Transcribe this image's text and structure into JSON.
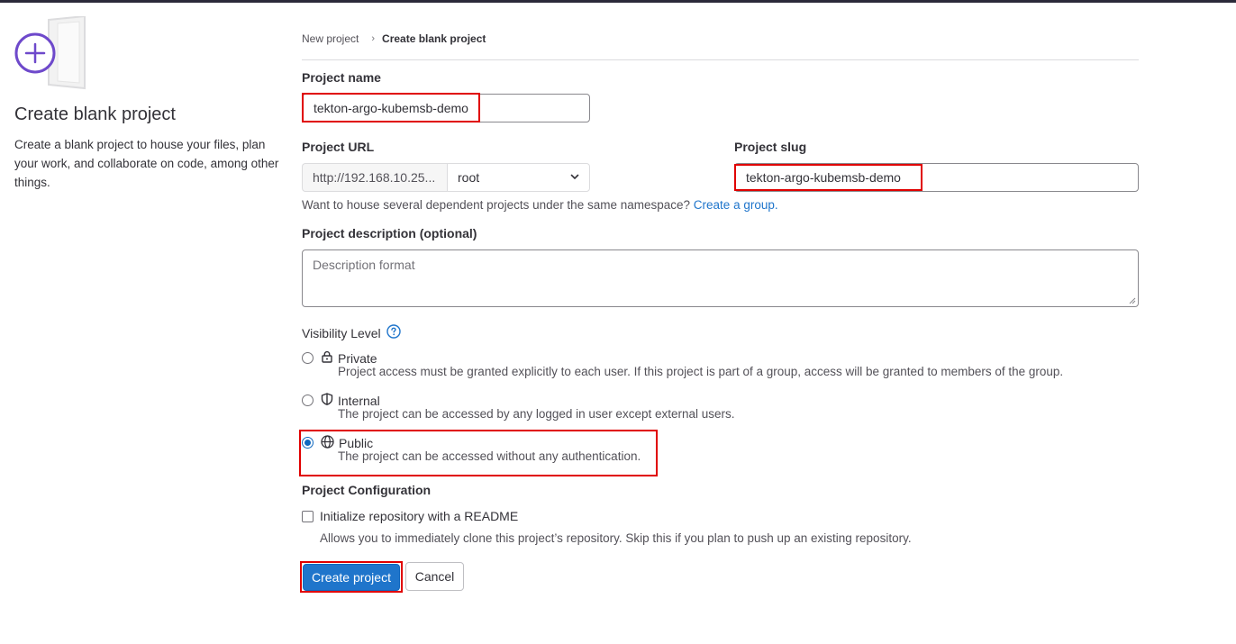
{
  "left": {
    "title": "Create blank project",
    "description": "Create a blank project to house your files, plan your work, and collaborate on code, among other things."
  },
  "breadcrumb": {
    "parent": "New project",
    "current": "Create blank project"
  },
  "form": {
    "project_name_label": "Project name",
    "project_name_value": "tekton-argo-kubemsb-demo",
    "project_url_label": "Project URL",
    "url_prefix": "http://192.168.10.25...",
    "namespace": "root",
    "project_slug_label": "Project slug",
    "project_slug_value": "tekton-argo-kubemsb-demo",
    "group_help_text": "Want to house several dependent projects under the same namespace?",
    "group_help_link": "Create a group.",
    "description_label": "Project description (optional)",
    "description_placeholder": "Description format"
  },
  "visibility": {
    "label": "Visibility Level",
    "selected": "public",
    "options": [
      {
        "title": "Private",
        "icon": "lock-icon",
        "desc": "Project access must be granted explicitly to each user. If this project is part of a group, access will be granted to members of the group."
      },
      {
        "title": "Internal",
        "icon": "shield-icon",
        "desc": "The project can be accessed by any logged in user except external users."
      },
      {
        "title": "Public",
        "icon": "globe-icon",
        "desc": "The project can be accessed without any authentication."
      }
    ]
  },
  "config": {
    "title": "Project Configuration",
    "readme_label": "Initialize repository with a README",
    "readme_checked": false,
    "readme_help": "Allows you to immediately clone this project’s repository. Skip this if you plan to push up an existing repository."
  },
  "actions": {
    "create": "Create project",
    "cancel": "Cancel"
  },
  "colors": {
    "primary": "#1f75cb",
    "highlight": "#e00000",
    "accent_purple": "#6e49cb"
  }
}
